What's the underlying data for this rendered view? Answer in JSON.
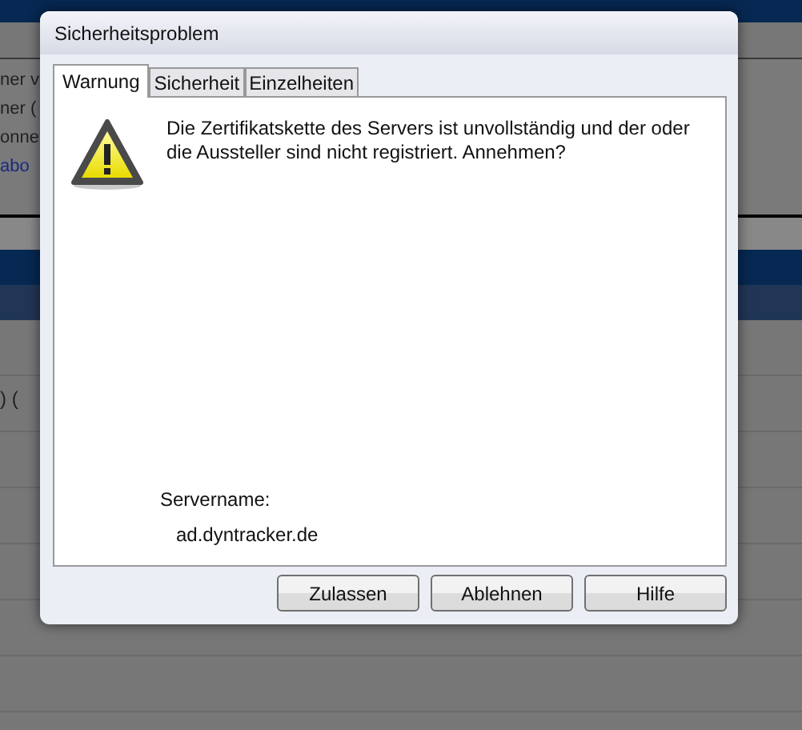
{
  "background": {
    "fragments": [
      {
        "text": "ner v",
        "kind": "plain"
      },
      {
        "text": "ner (",
        "kind": "plain"
      },
      {
        "text": "onne",
        "kind": "plain"
      },
      {
        "text": "abo",
        "kind": "link"
      }
    ],
    "lower_fragment": ") ("
  },
  "window": {
    "title": "Sicherheitsproblem"
  },
  "tabs": [
    {
      "label": "Warnung",
      "selected": true
    },
    {
      "label": "Sicherheit",
      "selected": false
    },
    {
      "label": "Einzelheiten",
      "selected": false
    }
  ],
  "message": "Die Zertifikatskette des Servers ist unvollständig und der oder die Aussteller sind nicht registriert. Annehmen?",
  "server": {
    "label": "Servername:",
    "value": "ad.dyntracker.de"
  },
  "buttons": [
    "Zulassen",
    "Ablehnen",
    "Hilfe"
  ]
}
